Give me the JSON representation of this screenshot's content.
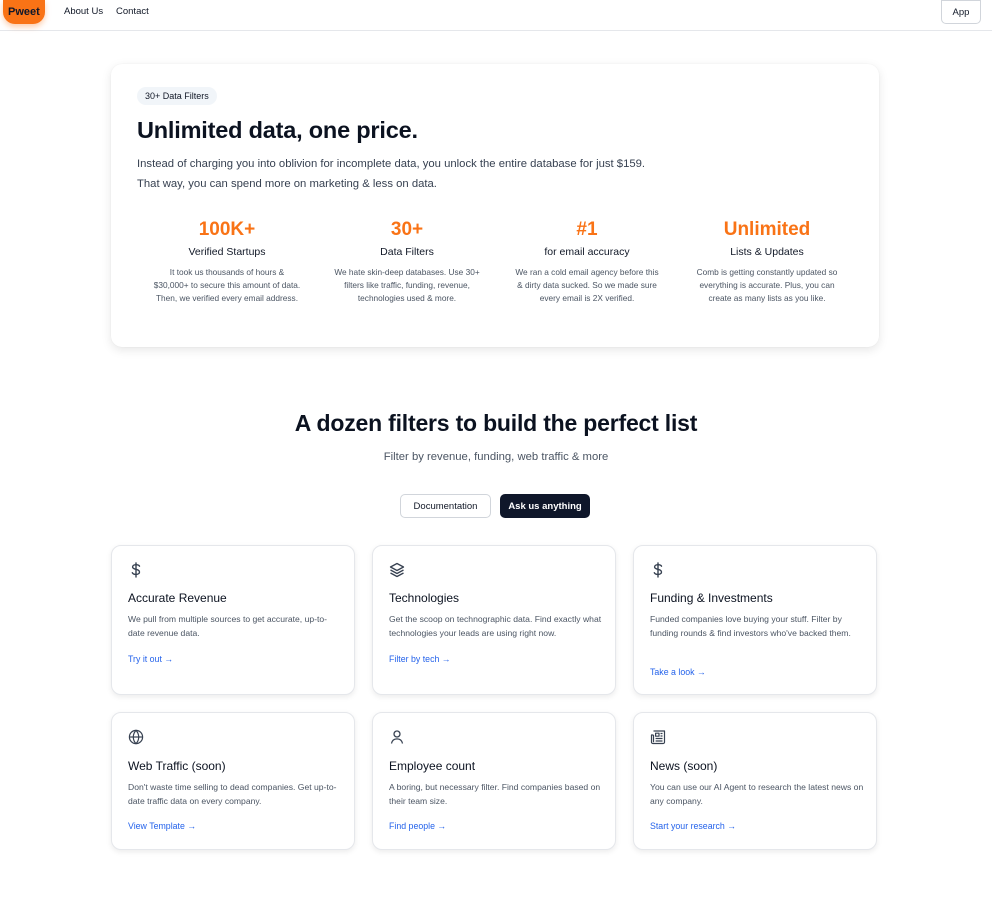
{
  "header": {
    "logo": "Pweet",
    "nav": [
      "About Us",
      "Contact"
    ],
    "app_button": "App"
  },
  "hero": {
    "badge": "30+ Data Filters",
    "title": "Unlimited data, one price.",
    "description": "Instead of charging you into oblivion for incomplete data, you unlock the entire database for just $159. That way, you can spend more on marketing & less on data.",
    "stats": [
      {
        "value": "100K+",
        "label": "Verified Startups",
        "desc": "It took us thousands of hours & $30,000+ to secure this amount of data. Then, we verified every email address."
      },
      {
        "value": "30+",
        "label": "Data Filters",
        "desc": "We hate skin-deep databases. Use 30+ filters like traffic, funding, revenue, technologies used & more."
      },
      {
        "value": "#1",
        "label": "for email accuracy",
        "desc": "We ran a cold email agency before this & dirty data sucked. So we made sure every email is 2X verified."
      },
      {
        "value": "Unlimited",
        "label": "Lists & Updates",
        "desc": "Comb is getting constantly updated so everything is accurate. Plus, you can create as many lists as you like."
      }
    ],
    "accent_color": "#f97316"
  },
  "filters_section": {
    "title": "A dozen filters to build the perfect list",
    "subtitle": "Filter by revenue, funding, web traffic & more",
    "buttons": {
      "documentation": "Documentation",
      "ask": "Ask us anything"
    }
  },
  "cards": [
    {
      "icon": "dollar-icon",
      "title": "Accurate Revenue",
      "desc": "We pull from multiple sources to get accurate, up-to-date revenue data.",
      "link": "Try it out →"
    },
    {
      "icon": "layers-icon",
      "title": "Technologies",
      "desc": "Get the scoop on technographic data. Find exactly what technologies your leads are using right now.",
      "link": "Filter by tech →"
    },
    {
      "icon": "dollar-icon",
      "title": "Funding & Investments",
      "desc": "Funded companies love buying your stuff. Filter by funding rounds & find investors who've backed them.",
      "link": "Take a look →"
    },
    {
      "icon": "globe-icon",
      "title": "Web Traffic (soon)",
      "desc": "Don't waste time selling to dead companies. Get up-to-date traffic data on every company.",
      "link": "View Template →"
    },
    {
      "icon": "user-icon",
      "title": "Employee count",
      "desc": "A boring, but necessary filter. Find companies based on their team size.",
      "link": "Find people →"
    },
    {
      "icon": "newspaper-icon",
      "title": "News (soon)",
      "desc": "You can use our AI Agent to research the latest news on any company.",
      "link": "Start your research →"
    }
  ]
}
